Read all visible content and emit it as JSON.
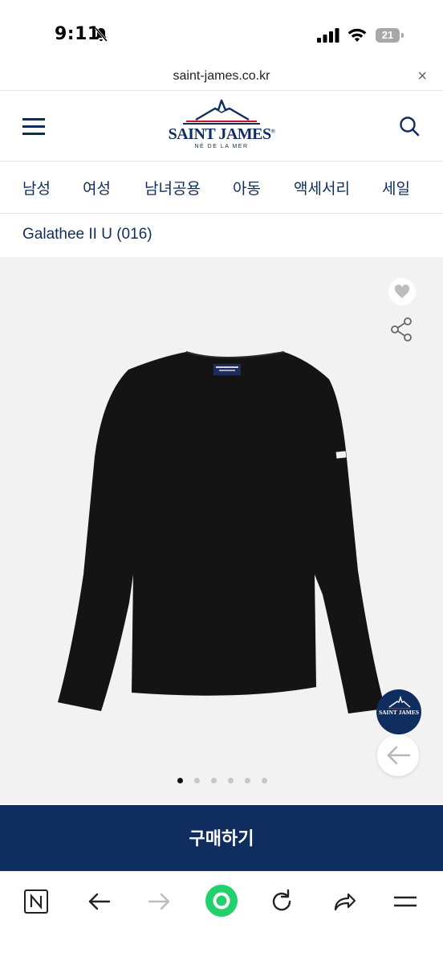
{
  "status_bar": {
    "time": "9:11",
    "battery": "21"
  },
  "browser": {
    "url": "saint-james.co.kr",
    "close_icon": "close-icon"
  },
  "header": {
    "brand": "SAINT JAMES",
    "brand_mark": "®",
    "tagline": "NÉ DE LA MER"
  },
  "nav": {
    "items": [
      "남성",
      "여성",
      "남녀공용",
      "아동",
      "액세서리",
      "세일"
    ]
  },
  "product": {
    "title": "Galathee II U (016)",
    "image_dots": 6,
    "active_dot": 1,
    "shirt_color": "#141414"
  },
  "badge": {
    "text": "SAINT JAMES"
  },
  "cta": {
    "label": "구매하기"
  },
  "colors": {
    "brand_navy": "#0f2d5e",
    "image_bg": "#f2f2f3",
    "reload_accent": "#22d16b"
  }
}
